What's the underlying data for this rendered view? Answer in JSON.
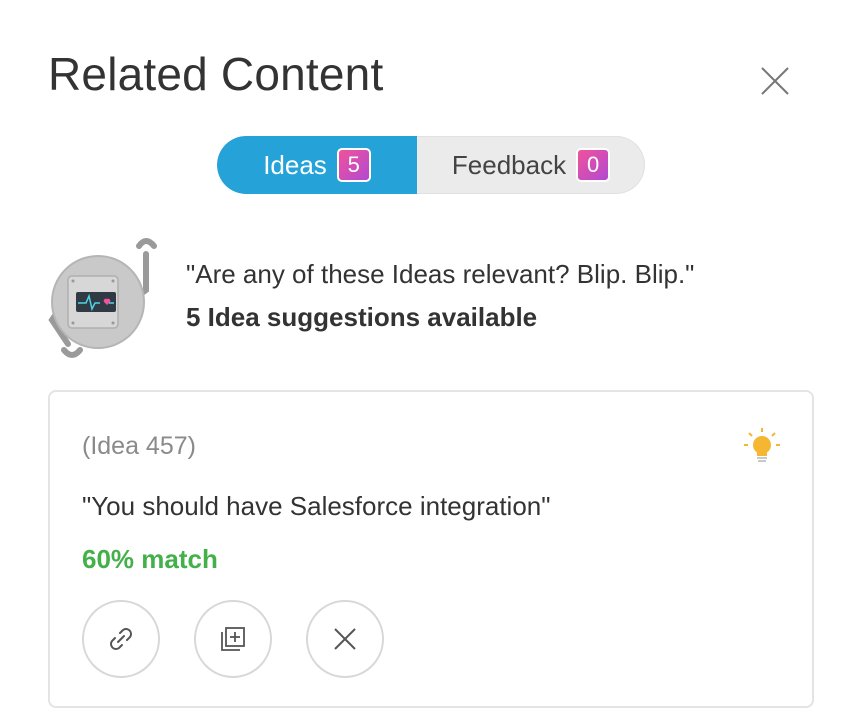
{
  "panel": {
    "title": "Related Content",
    "close_icon": "close-icon"
  },
  "tabs": [
    {
      "label": "Ideas",
      "count": "5",
      "active": true
    },
    {
      "label": "Feedback",
      "count": "0",
      "active": false
    }
  ],
  "bot": {
    "icon": "robot-icon",
    "quote": "\"Are any of these Ideas relevant? Blip. Blip.\"",
    "count_text": "5 Idea suggestions available"
  },
  "card": {
    "idea_id": "(Idea 457)",
    "idea_title": "\"You should have Salesforce integration\"",
    "match": "60% match",
    "icon": "lightbulb-icon",
    "actions": [
      {
        "name": "link-icon"
      },
      {
        "name": "merge-icon"
      },
      {
        "name": "dismiss-icon"
      }
    ]
  },
  "colors": {
    "accent": "#25a3d9",
    "match_green": "#44b04a",
    "badge_pink": "#f0529b",
    "badge_purple": "#b24ad1",
    "bulb_yellow": "#f5b731"
  }
}
